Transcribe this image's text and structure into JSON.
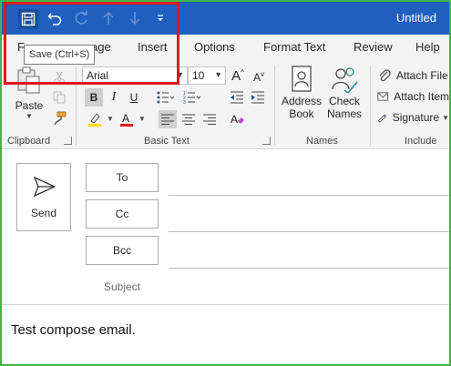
{
  "window": {
    "title": "Untitled",
    "tooltip": "Save (Ctrl+S)"
  },
  "tabs": [
    "F",
    "age",
    "Insert",
    "Options",
    "Format Text",
    "Review",
    "Help"
  ],
  "ribbon": {
    "clipboard": {
      "label": "Clipboard",
      "paste": "Paste"
    },
    "basic_text": {
      "label": "Basic Text",
      "font": "Arial",
      "size": "10",
      "bold": "B",
      "italic": "I",
      "underline": "U"
    },
    "names": {
      "label": "Names",
      "address_book_1": "Address",
      "address_book_2": "Book",
      "check_names_1": "Check",
      "check_names_2": "Names"
    },
    "include": {
      "label": "Include",
      "attach_file": "Attach File",
      "attach_item": "Attach Item",
      "signature": "Signature"
    }
  },
  "compose": {
    "send": "Send",
    "to": "To",
    "cc": "Cc",
    "bcc": "Bcc",
    "subject_placeholder": "Subject",
    "body": "Test compose email."
  },
  "colors": {
    "titlebar": "#1f5fbf",
    "highlight_border": "#e0161d",
    "window_border": "#3fb54a",
    "highlight_yellow": "#ffd800",
    "font_color_red": "#e01c1c"
  }
}
